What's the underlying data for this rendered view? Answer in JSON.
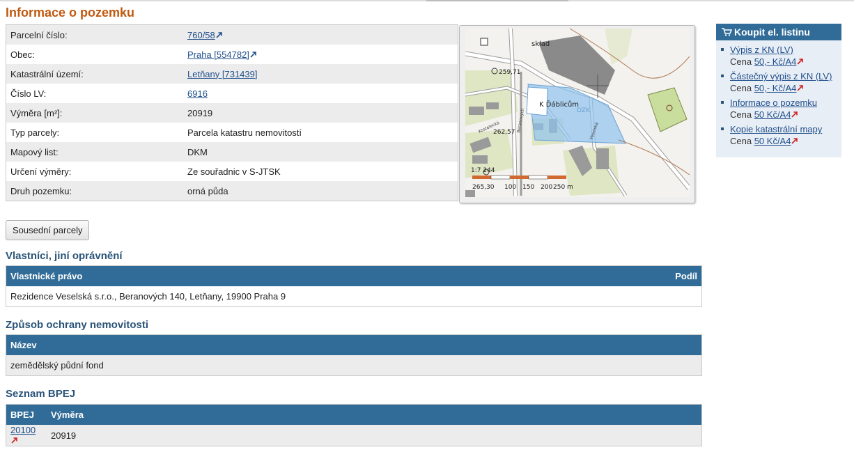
{
  "page_title": "Informace o pozemku",
  "parcel": {
    "rows": [
      {
        "label": "Parcelní číslo:",
        "value": "760/58",
        "link": true
      },
      {
        "label": "Obec:",
        "value": "Praha [554782]",
        "link": true
      },
      {
        "label": "Katastrální území:",
        "value": "Letňany [731439]",
        "link": true,
        "no_icon": true
      },
      {
        "label": "Číslo LV:",
        "value": "6916",
        "link": true,
        "no_icon": true
      },
      {
        "label": "Výměra [m²]:",
        "value": "20919",
        "link": false
      },
      {
        "label": "Typ parcely:",
        "value": "Parcela katastru nemovitostí",
        "link": false
      },
      {
        "label": "Mapový list:",
        "value": "DKM",
        "link": false
      },
      {
        "label": "Určení výměry:",
        "value": "Ze souřadnic v S-JTSK",
        "link": false
      },
      {
        "label": "Druh pozemku:",
        "value": "orná půda",
        "link": false
      }
    ]
  },
  "map": {
    "labels": {
      "sklad": "sklad",
      "street": "K Ďáblicům",
      "dzk": "DZK",
      "height1": "259,71",
      "height2": "262,57",
      "height3": "265,30",
      "scale_ratio": "1:7 244",
      "scale_100": "100",
      "scale_150": "150",
      "scale_200": "200",
      "scale_250": "250 m",
      "road1": "Kostelecká",
      "road2": "Beranových",
      "road3": "Veselská"
    }
  },
  "buttons": {
    "sousedni": "Sousední parcely"
  },
  "owners": {
    "title": "Vlastníci, jiní oprávnění",
    "col1": "Vlastnické právo",
    "col2": "Podíl",
    "rows": [
      {
        "name": "Rezidence Veselská s.r.o., Beranových 140, Letňany, 19900 Praha 9",
        "share": ""
      }
    ]
  },
  "protection": {
    "title": "Způsob ochrany nemovitosti",
    "col1": "Název",
    "rows": [
      {
        "name": "zemědělský půdní fond"
      }
    ]
  },
  "bpej": {
    "title": "Seznam BPEJ",
    "col1": "BPEJ",
    "col2": "Výměra",
    "rows": [
      {
        "code": "20100",
        "area": "20919"
      }
    ]
  },
  "sidebar": {
    "header": "Koupit el. listinu",
    "items": [
      {
        "title": "Výpis z KN (LV)",
        "price_prefix": "Cena ",
        "price": "50,- Kč/A4"
      },
      {
        "title": "Částečný výpis z KN (LV)",
        "price_prefix": "Cena ",
        "price": "50,- Kč/A4"
      },
      {
        "title": "Informace o pozemku",
        "price_prefix": "Cena ",
        "price": "50 Kč/A4"
      },
      {
        "title": "Kopie katastrální mapy",
        "price_prefix": "Cena ",
        "price": "50 Kč/A4"
      }
    ]
  },
  "colors": {
    "title_orange": "#c05a10",
    "header_blue": "#316c98",
    "section_blue": "#2a5478",
    "link_blue": "#1f4e8c"
  }
}
